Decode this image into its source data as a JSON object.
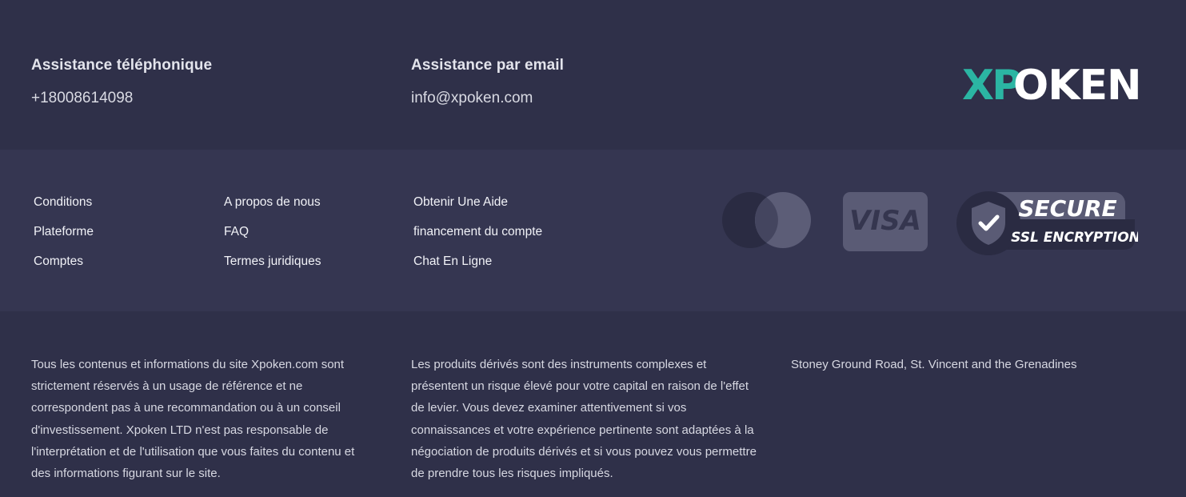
{
  "contact": {
    "phone": {
      "title": "Assistance téléphonique",
      "value": "+18008614098"
    },
    "email": {
      "title": "Assistance par email",
      "value": "info@xpoken.com"
    }
  },
  "logo": {
    "prefix": "XP",
    "suffix": "OKEN",
    "prefix_color": "#2bb5a3",
    "suffix_color": "#ffffff"
  },
  "links": {
    "col1": [
      "Conditions",
      "Plateforme",
      "Comptes"
    ],
    "col2": [
      "A propos de nous",
      "FAQ",
      "Termes juridiques"
    ],
    "col3": [
      "Obtenir Une Aide",
      "financement du compte",
      "Chat En Ligne"
    ]
  },
  "payments": {
    "visa_label": "VISA",
    "ssl_line1": "SECURE",
    "ssl_line2": "SSL ENCRYPTION",
    "icons": [
      "mastercard-icon",
      "visa-icon",
      "ssl-shield-icon"
    ]
  },
  "footer": {
    "disclaimer": "Tous les contenus et informations du site Xpoken.com sont strictement réservés à un usage de référence et ne correspondent pas à une recommandation ou à un conseil d'investissement. Xpoken LTD n'est pas responsable de l'interprétation et de l'utilisation que vous faites du contenu et des informations figurant sur le site.",
    "risk": "Les produits dérivés sont des instruments complexes et présentent un risque élevé pour votre capital en raison de l'effet de levier. Vous devez examiner attentivement si vos connaissances et votre expérience pertinente sont adaptées à la négociation de produits dérivés et si vous pouvez vous permettre de prendre tous les risques impliqués.",
    "address": "Stoney Ground Road, St. Vincent and the Grenadines"
  },
  "colors": {
    "background": "#2f3049",
    "band": "#353651",
    "accent": "#2bb5a3"
  }
}
